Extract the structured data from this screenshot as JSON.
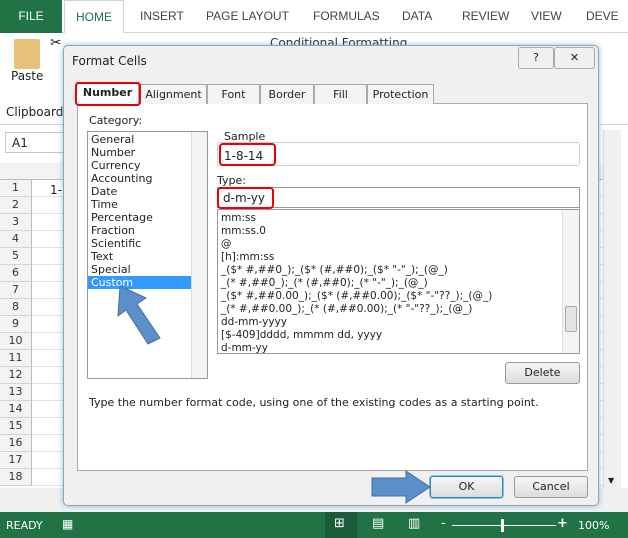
{
  "ribbon": {
    "tabs": [
      "FILE",
      "HOME",
      "INSERT",
      "PAGE LAYOUT",
      "FORMULAS",
      "DATA",
      "REVIEW",
      "VIEW",
      "DEVE"
    ],
    "paste": "Paste",
    "clipboard": "Clipboard",
    "conditional_formatting": "Conditional Formatting"
  },
  "formula_bar": {
    "name_box": "A1"
  },
  "grid": {
    "rows": [
      "1",
      "2",
      "3",
      "4",
      "5",
      "6",
      "7",
      "8",
      "9",
      "10",
      "11",
      "12",
      "13",
      "14",
      "15",
      "16",
      "17",
      "18"
    ],
    "a1_value": "1-"
  },
  "status": {
    "ready": "READY",
    "zoom": "100%"
  },
  "dialog": {
    "title": "Format Cells",
    "help": "?",
    "close": "✕",
    "tabs": [
      "Number",
      "Alignment",
      "Font",
      "Border",
      "Fill",
      "Protection"
    ],
    "category_label": "Category:",
    "categories": [
      "General",
      "Number",
      "Currency",
      "Accounting",
      "Date",
      "Time",
      "Percentage",
      "Fraction",
      "Scientific",
      "Text",
      "Special",
      "Custom"
    ],
    "selected_category": "Custom",
    "sample_label": "Sample",
    "sample_value": "1-8-14",
    "type_label": "Type:",
    "type_value": "d-m-yy",
    "formats": [
      "mm:ss",
      "mm:ss.0",
      "@",
      "[h]:mm:ss",
      "_($* #,##0_);_($* (#,##0);_($* \"-\"_);_(@_)",
      "_(* #,##0_);_(* (#,##0);_(* \"-\"_);_(@_)",
      "_($* #,##0.00_);_($* (#,##0.00);_($* \"-\"??_);_(@_)",
      "_(* #,##0.00_);_(* (#,##0.00);_(* \"-\"??_);_(@_)",
      "dd-mm-yyyy",
      "[$-409]dddd, mmmm dd, yyyy",
      "d-mm-yy"
    ],
    "delete": "Delete",
    "hint": "Type the number format code, using one of the existing codes as a starting point.",
    "ok": "OK",
    "cancel": "Cancel"
  },
  "colors": {
    "excel_green": "#217346",
    "highlight_red": "#e00000",
    "selection_blue": "#3399ff",
    "arrow_blue": "#5b8fc9"
  }
}
